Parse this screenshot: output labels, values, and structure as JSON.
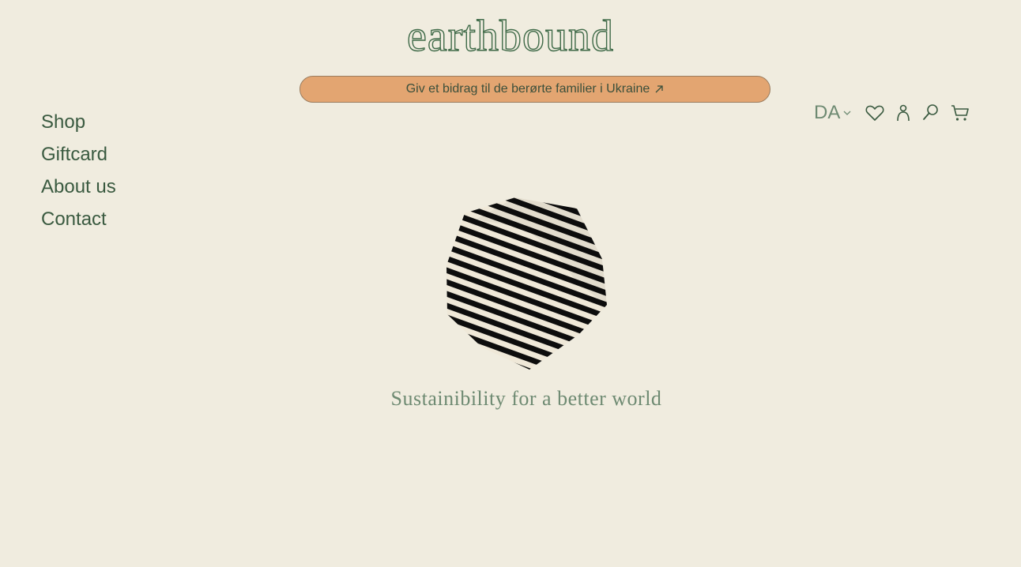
{
  "header": {
    "logo_text": "earthbound",
    "banner_text": "Giv et bidrag til de berørte familier i Ukraine",
    "banner_icon": "arrow-up-right-icon"
  },
  "nav": {
    "items": [
      {
        "label": "Shop"
      },
      {
        "label": "Giftcard"
      },
      {
        "label": "About us"
      },
      {
        "label": "Contact"
      }
    ]
  },
  "toolbar": {
    "language": "DA",
    "icons": [
      "heart-icon",
      "account-icon",
      "search-icon",
      "cart-icon"
    ]
  },
  "hero": {
    "tagline": "Sustainibility for a better world"
  },
  "colors": {
    "background": "#f0ecdf",
    "brand_green": "#3a5a40",
    "banner_fill": "#e3a571"
  }
}
